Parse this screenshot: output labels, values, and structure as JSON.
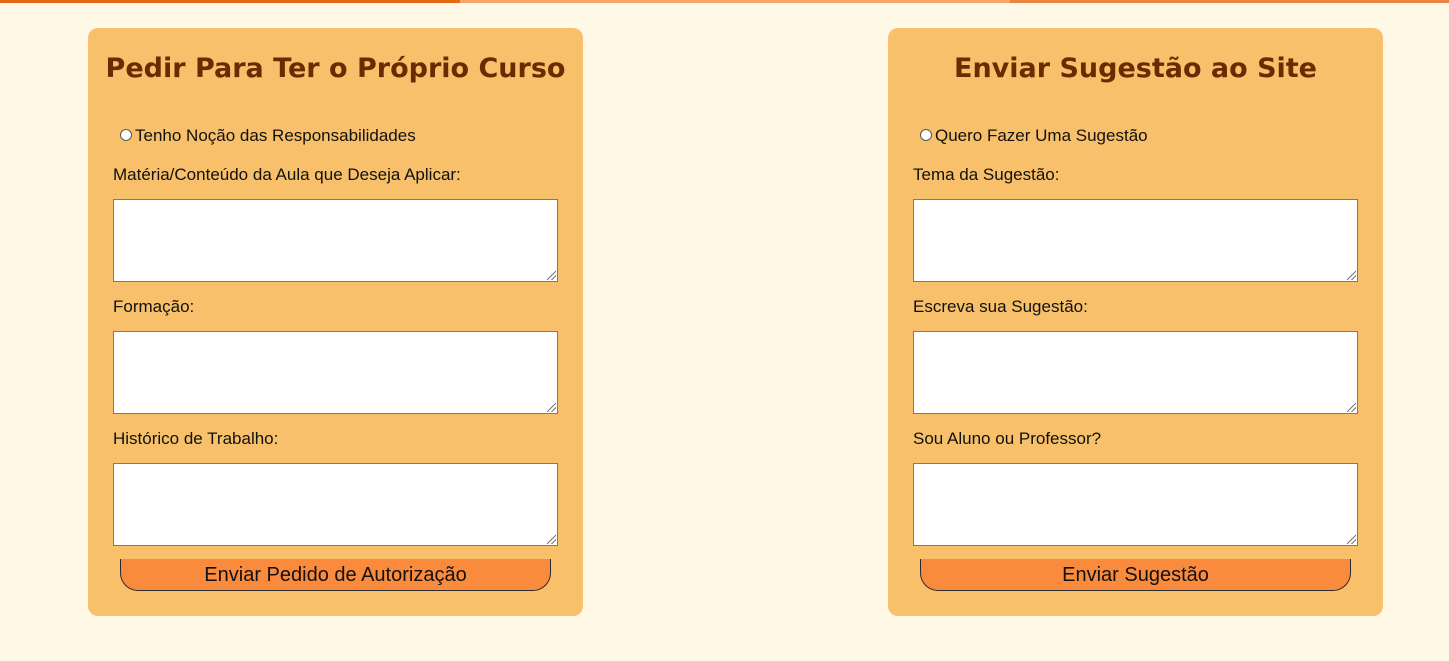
{
  "colors": {
    "page_bg": "#fff8e6",
    "card_bg": "#f8c06a",
    "title": "#6b2b00",
    "button_bg": "#fa8a3c",
    "top_accent": "#e46a14"
  },
  "cards": [
    {
      "title": "Pedir Para Ter o Próprio Curso",
      "radio_label": "Tenho Noção das Responsabilidades",
      "fields": [
        {
          "label": "Matéria/Conteúdo da Aula que Deseja Aplicar:",
          "value": ""
        },
        {
          "label": "Formação:",
          "value": ""
        },
        {
          "label": "Histórico de Trabalho:",
          "value": ""
        }
      ],
      "button": "Enviar Pedido de Autorização"
    },
    {
      "title": "Enviar Sugestão ao Site",
      "radio_label": "Quero Fazer Uma Sugestão",
      "fields": [
        {
          "label": "Tema da Sugestão:",
          "value": ""
        },
        {
          "label": "Escreva sua Sugestão:",
          "value": ""
        },
        {
          "label": "Sou Aluno ou Professor?",
          "value": ""
        }
      ],
      "button": "Enviar Sugestão"
    }
  ]
}
